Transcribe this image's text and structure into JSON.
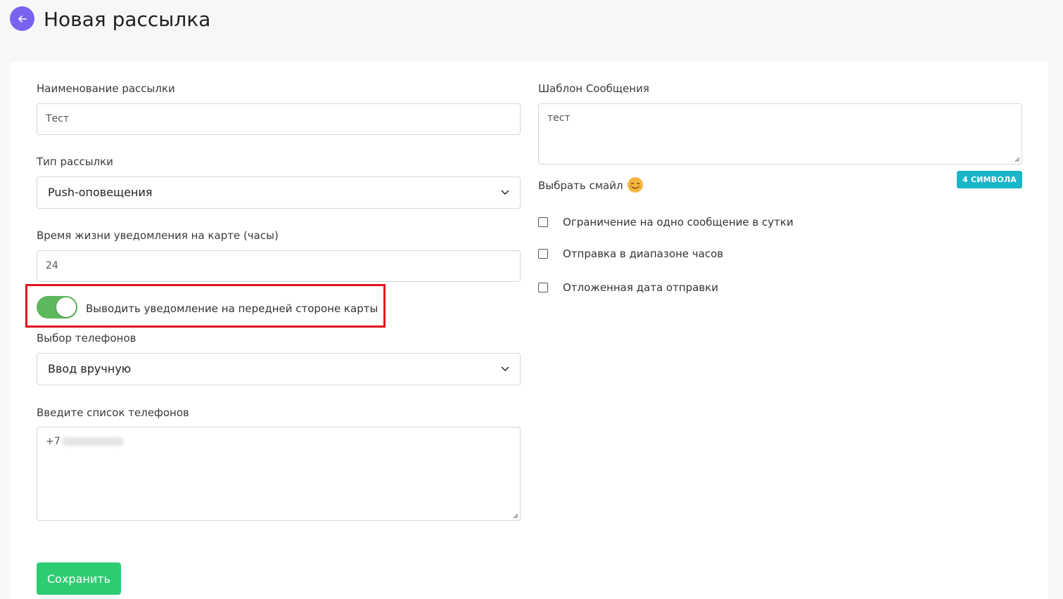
{
  "header": {
    "title": "Новая рассылка"
  },
  "form": {
    "name_label": "Наименование рассылки",
    "name_value": "Тест",
    "type_label": "Тип рассылки",
    "type_value": "Push-оповещения",
    "ttl_label": "Время жизни уведомления на карте (часы)",
    "ttl_value": "24",
    "front_toggle_label": "Выводить уведомление на передней стороне карты",
    "front_toggle_on": true,
    "phones_mode_label": "Выбор телефонов",
    "phones_mode_value": "Ввод вручную",
    "phones_list_label": "Введите список телефонов",
    "phones_list_prefix": "+7",
    "template_label": "Шаблон Сообщения",
    "template_value": "тест",
    "char_counter": "4 СИМВОЛА",
    "emoji_label": "Выбрать смайл",
    "checkboxes": [
      {
        "label": "Ограничение на одно сообщение в сутки",
        "checked": false
      },
      {
        "label": "Отправка в диапазоне часов",
        "checked": false
      },
      {
        "label": "Отложенная дата отправки",
        "checked": false
      }
    ],
    "save_label": "Сохранить"
  },
  "colors": {
    "back_button": "#7b61f0",
    "toggle_on": "#5cb85c",
    "counter_badge": "#19b5c9",
    "save_button": "#2ecc71",
    "highlight_frame": "#e2121f"
  }
}
